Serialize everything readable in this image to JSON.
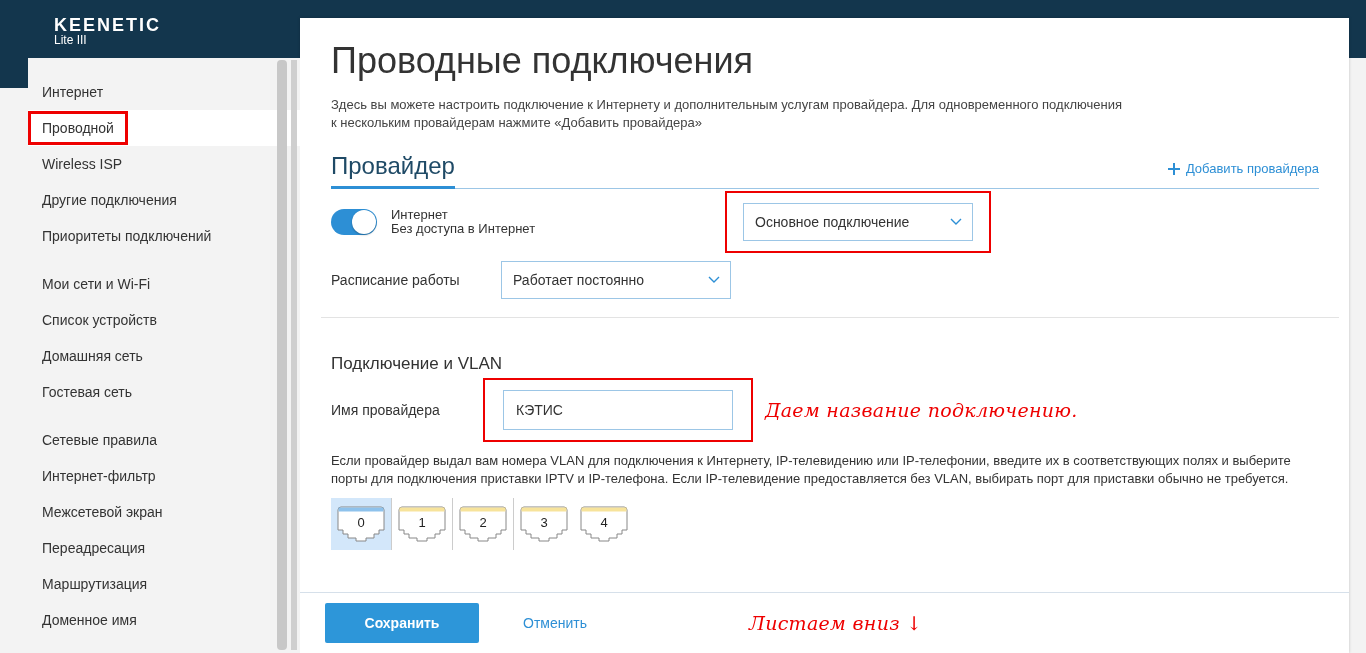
{
  "logo": {
    "brand": "KEENETIC",
    "model": "Lite III"
  },
  "sidebar": {
    "groups": [
      {
        "items": [
          {
            "label": "Интернет",
            "selected": false,
            "highlighted": false
          },
          {
            "label": "Проводной",
            "selected": true,
            "highlighted": true
          },
          {
            "label": "Wireless ISP",
            "selected": false,
            "highlighted": false
          },
          {
            "label": "Другие подключения",
            "selected": false,
            "highlighted": false
          },
          {
            "label": "Приоритеты подключений",
            "selected": false,
            "highlighted": false
          }
        ]
      },
      {
        "items": [
          {
            "label": "Мои сети и Wi-Fi",
            "selected": false,
            "highlighted": false
          },
          {
            "label": "Список устройств",
            "selected": false,
            "highlighted": false
          },
          {
            "label": "Домашняя сеть",
            "selected": false,
            "highlighted": false
          },
          {
            "label": "Гостевая сеть",
            "selected": false,
            "highlighted": false
          }
        ]
      },
      {
        "items": [
          {
            "label": "Сетевые правила",
            "selected": false,
            "highlighted": false
          },
          {
            "label": "Интернет-фильтр",
            "selected": false,
            "highlighted": false
          },
          {
            "label": "Межсетевой экран",
            "selected": false,
            "highlighted": false
          },
          {
            "label": "Переадресация",
            "selected": false,
            "highlighted": false
          },
          {
            "label": "Маршрутизация",
            "selected": false,
            "highlighted": false
          },
          {
            "label": "Доменное имя",
            "selected": false,
            "highlighted": false
          }
        ]
      }
    ]
  },
  "page": {
    "title": "Проводные подключения",
    "description": "Здесь вы можете настроить подключение к Интернету и дополнительным услугам провайдера. Для одновременного подключения к нескольким провайдерам нажмите «Добавить провайдера»"
  },
  "provider_section": {
    "tab": "Провайдер",
    "add_button": "Добавить провайдера",
    "toggle": {
      "label": "Интернет",
      "status": "Без доступа в Интернет",
      "on": true
    },
    "connection_type": {
      "value": "Основное подключение",
      "highlighted": true
    },
    "schedule": {
      "label": "Расписание работы",
      "value": "Работает постоянно"
    }
  },
  "vlan_section": {
    "title": "Подключение и VLAN",
    "provider_name": {
      "label": "Имя провайдера",
      "value": "КЭТИС",
      "highlighted": true
    },
    "annotation": "Даем название подключению.",
    "note": "Если провайдер выдал вам номера VLAN для подключения к Интернету, IP-телевидению или IP-телефонии, введите их в соответствующих полях и выберите порты для подключения приставки IPTV и IP-телефона. Если IP-телевидение предоставляется без VLAN, выбирать порт для приставки обычно не требуется.",
    "port_groups": [
      {
        "ports": [
          {
            "label": "0",
            "selected": true
          }
        ]
      },
      {
        "ports": [
          {
            "label": "1",
            "selected": false
          }
        ]
      },
      {
        "ports": [
          {
            "label": "2",
            "selected": false
          }
        ]
      },
      {
        "ports": [
          {
            "label": "3",
            "selected": false
          },
          {
            "label": "4",
            "selected": false
          }
        ]
      }
    ]
  },
  "footer": {
    "save": "Сохранить",
    "cancel": "Отменить",
    "annotation": "Листаем вниз ↓"
  }
}
